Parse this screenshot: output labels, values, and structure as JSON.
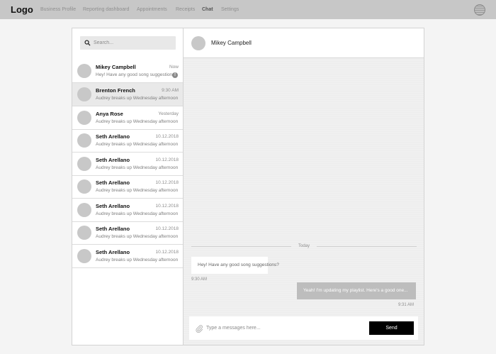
{
  "nav": {
    "logo": "Logo",
    "items": [
      {
        "label": "Business Profile",
        "active": false
      },
      {
        "label": "Reporting dashboard",
        "active": false
      },
      {
        "label": "Appointments",
        "active": false
      },
      {
        "label": "Receipts",
        "active": false
      },
      {
        "label": "Chat",
        "active": true
      },
      {
        "label": "Settings",
        "active": false
      }
    ],
    "avatar_icon": "globe-avatar-icon"
  },
  "search": {
    "placeholder": "Search...",
    "icon": "search-icon"
  },
  "conversations": [
    {
      "name": "Mikey Campbell",
      "time": "Now",
      "preview": "Hey! Have any good song suggestions?",
      "unread_badge": "!",
      "selected": false
    },
    {
      "name": "Brenton French",
      "time": "9:30 AM",
      "preview": "Audrey breaks up Wednesday afternoon",
      "selected": true
    },
    {
      "name": "Anya Rose",
      "time": "Yesterday",
      "preview": "Audrey breaks up Wednesday afternoon",
      "selected": false
    },
    {
      "name": "Seth Arellano",
      "time": "10.12.2018",
      "preview": "Audrey breaks up Wednesday afternoon",
      "selected": false
    },
    {
      "name": "Seth Arellano",
      "time": "10.12.2018",
      "preview": "Audrey breaks up Wednesday afternoon",
      "selected": false
    },
    {
      "name": "Seth Arellano",
      "time": "10.12.2018",
      "preview": "Audrey breaks up Wednesday afternoon",
      "selected": false
    },
    {
      "name": "Seth Arellano",
      "time": "10.12.2018",
      "preview": "Audrey breaks up Wednesday afternoon",
      "selected": false
    },
    {
      "name": "Seth Arellano",
      "time": "10.12.2018",
      "preview": "Audrey breaks up Wednesday afternoon",
      "selected": false
    },
    {
      "name": "Seth Arellano",
      "time": "10.12.2018",
      "preview": "Audrey breaks up Wednesday afternoon",
      "selected": false
    }
  ],
  "chat": {
    "contact_name": "Mikey Campbell",
    "divider_label": "Today",
    "messages": [
      {
        "direction": "incoming",
        "text": "Hey! Have any good song suggestions?",
        "time": "9:30 AM"
      },
      {
        "direction": "outgoing",
        "text": "Yeah! I'm updating my playlist. Here's a good one...",
        "time": "9:31 AM"
      }
    ],
    "composer": {
      "placeholder": "Type a messages here...",
      "send_label": "Send",
      "attach_icon": "paperclip-icon"
    }
  },
  "colors": {
    "nav_bg": "#c7c7c7",
    "send_button": "#000000",
    "outgoing_bubble": "#bdbdbd",
    "selected_row": "#e9e9e9"
  }
}
